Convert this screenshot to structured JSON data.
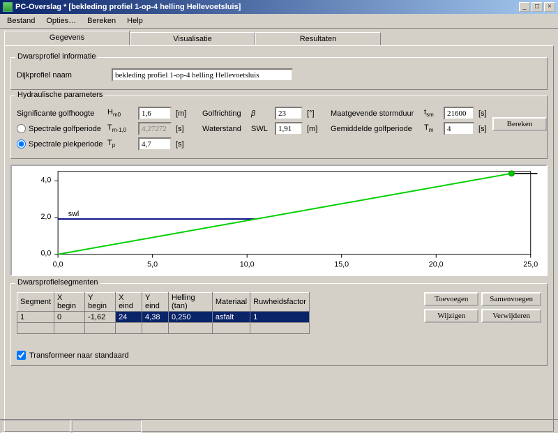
{
  "window": {
    "title": "PC-Overslag * [bekleding profiel 1-op-4 helling Hellevoetsluis]"
  },
  "menu": {
    "bestand": "Bestand",
    "opties": "Opties…",
    "bereken": "Bereken",
    "help": "Help"
  },
  "tabs": {
    "gegevens": "Gegevens",
    "visualisatie": "Visualisatie",
    "resultaten": "Resultaten"
  },
  "dwarsprofiel_info": {
    "legend": "Dwarsprofiel informatie",
    "naam_label": "Dijkprofiel naam",
    "naam_value": "bekleding profiel 1-op-4 helling Hellevoetsluis"
  },
  "hydraulic": {
    "legend": "Hydraulische parameters",
    "sig_golfhoogte": "Significante golfhoogte",
    "Hm0_sym": "Hm0",
    "Hm0_val": "1,6",
    "Hm0_unit": "[m]",
    "spectrale_golfperiode": "Spectrale golfperiode",
    "Tm10_sym": "Tm-1,0",
    "Tm10_val": "4,27272",
    "Tm10_unit": "[s]",
    "spectrale_piekperiode": "Spectrale piekperiode",
    "Tp_sym": "Tp",
    "Tp_val": "4,7",
    "Tp_unit": "[s]",
    "golfrichting": "Golfrichting",
    "beta_sym": "β",
    "beta_val": "23",
    "beta_unit": "[°]",
    "waterstand": "Waterstand",
    "swl_sym": "SWL",
    "swl_val": "1,91",
    "swl_unit": "[m]",
    "stormduur": "Maatgevende stormduur",
    "tsm_sym": "tsm",
    "tsm_val": "21600",
    "tsm_unit": "[s]",
    "gem_golfperiode": "Gemiddelde golfperiode",
    "Tm_sym": "Tm",
    "Tm_val": "4",
    "Tm_unit": "[s]",
    "bereken_btn": "Bereken"
  },
  "chart_data": {
    "type": "line",
    "xlim": [
      0,
      25
    ],
    "ylim": [
      0,
      4.5
    ],
    "x_ticks": [
      "0,0",
      "5,0",
      "10,0",
      "15,0",
      "20,0",
      "25,0"
    ],
    "y_ticks": [
      "0,0",
      "2,0",
      "4,0"
    ],
    "swl_label": "swl",
    "swl_value": 1.91,
    "series": [
      {
        "name": "profile",
        "color": "#00d000",
        "x": [
          0,
          24
        ],
        "y": [
          0,
          4.38
        ]
      },
      {
        "name": "top-segment",
        "color": "#000000",
        "x": [
          24,
          25.5
        ],
        "y": [
          4.4,
          4.4
        ]
      }
    ],
    "marker": {
      "x": 24,
      "y": 4.38,
      "color": "#00d000"
    }
  },
  "segments": {
    "legend": "Dwarsprofielsegmenten",
    "headers": [
      "Segment",
      "X begin",
      "Y begin",
      "X eind",
      "Y eind",
      "Helling (tan)",
      "Materiaal",
      "Ruwheidsfactor"
    ],
    "rows": [
      {
        "segment": "1",
        "xbegin": "0",
        "ybegin": "-1,62",
        "xeind": "24",
        "yeind": "4,38",
        "helling": "0,250",
        "materiaal": "asfalt",
        "ruw": "1"
      }
    ],
    "buttons": {
      "toevoegen": "Toevoegen",
      "samenvoegen": "Samenvoegen",
      "wijzigen": "Wijzigen",
      "verwijderen": "Verwijderen"
    },
    "transform_cb": "Transformeer naar standaard",
    "transform_checked": true
  }
}
